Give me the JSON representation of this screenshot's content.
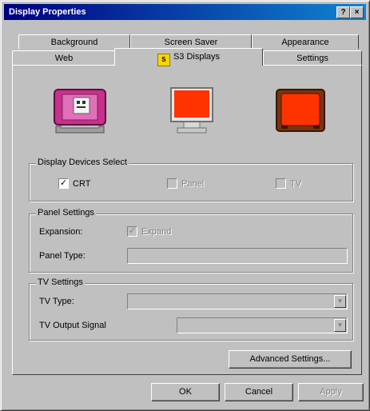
{
  "window": {
    "title": "Display Properties",
    "help_btn": "?",
    "close_btn": "×"
  },
  "tabs": {
    "back_row": [
      "Background",
      "Screen Saver",
      "Appearance"
    ],
    "front_row": [
      "Web",
      "S3 Displays",
      "Settings"
    ],
    "active": "S3 Displays"
  },
  "devices_group": {
    "label": "Display Devices Select",
    "crt": {
      "label": "CRT",
      "checked": true,
      "mark": "✓"
    },
    "panel": {
      "label": "Panel",
      "checked": false
    },
    "tv": {
      "label": "TV",
      "checked": false
    }
  },
  "panel_settings": {
    "label": "Panel Settings",
    "expansion_label": "Expansion:",
    "expand_label": "Expand",
    "expand_mark": "✓",
    "panel_type_label": "Panel Type:",
    "panel_type_value": ""
  },
  "tv_settings": {
    "label": "TV Settings",
    "tv_type_label": "TV Type:",
    "tv_type_value": "",
    "tv_output_label": "TV Output Signal",
    "tv_output_value": "",
    "dd_arrow": "▼"
  },
  "buttons": {
    "advanced": "Advanced Settings...",
    "ok": "OK",
    "cancel": "Cancel",
    "apply": "Apply"
  },
  "colors": {
    "title_bar": "#000080",
    "face": "#c0c0c0",
    "screen_red": "#ff3300",
    "crt_magenta": "#c8308c"
  }
}
